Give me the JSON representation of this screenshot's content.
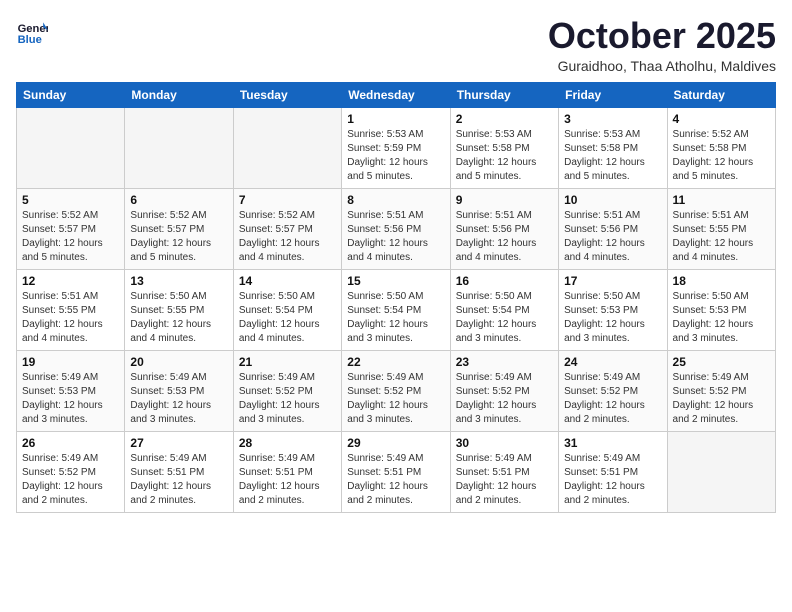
{
  "header": {
    "logo_line1": "General",
    "logo_line2": "Blue",
    "month": "October 2025",
    "location": "Guraidhoo, Thaa Atholhu, Maldives"
  },
  "weekdays": [
    "Sunday",
    "Monday",
    "Tuesday",
    "Wednesday",
    "Thursday",
    "Friday",
    "Saturday"
  ],
  "weeks": [
    [
      {
        "day": "",
        "info": ""
      },
      {
        "day": "",
        "info": ""
      },
      {
        "day": "",
        "info": ""
      },
      {
        "day": "1",
        "info": "Sunrise: 5:53 AM\nSunset: 5:59 PM\nDaylight: 12 hours\nand 5 minutes."
      },
      {
        "day": "2",
        "info": "Sunrise: 5:53 AM\nSunset: 5:58 PM\nDaylight: 12 hours\nand 5 minutes."
      },
      {
        "day": "3",
        "info": "Sunrise: 5:53 AM\nSunset: 5:58 PM\nDaylight: 12 hours\nand 5 minutes."
      },
      {
        "day": "4",
        "info": "Sunrise: 5:52 AM\nSunset: 5:58 PM\nDaylight: 12 hours\nand 5 minutes."
      }
    ],
    [
      {
        "day": "5",
        "info": "Sunrise: 5:52 AM\nSunset: 5:57 PM\nDaylight: 12 hours\nand 5 minutes."
      },
      {
        "day": "6",
        "info": "Sunrise: 5:52 AM\nSunset: 5:57 PM\nDaylight: 12 hours\nand 5 minutes."
      },
      {
        "day": "7",
        "info": "Sunrise: 5:52 AM\nSunset: 5:57 PM\nDaylight: 12 hours\nand 4 minutes."
      },
      {
        "day": "8",
        "info": "Sunrise: 5:51 AM\nSunset: 5:56 PM\nDaylight: 12 hours\nand 4 minutes."
      },
      {
        "day": "9",
        "info": "Sunrise: 5:51 AM\nSunset: 5:56 PM\nDaylight: 12 hours\nand 4 minutes."
      },
      {
        "day": "10",
        "info": "Sunrise: 5:51 AM\nSunset: 5:56 PM\nDaylight: 12 hours\nand 4 minutes."
      },
      {
        "day": "11",
        "info": "Sunrise: 5:51 AM\nSunset: 5:55 PM\nDaylight: 12 hours\nand 4 minutes."
      }
    ],
    [
      {
        "day": "12",
        "info": "Sunrise: 5:51 AM\nSunset: 5:55 PM\nDaylight: 12 hours\nand 4 minutes."
      },
      {
        "day": "13",
        "info": "Sunrise: 5:50 AM\nSunset: 5:55 PM\nDaylight: 12 hours\nand 4 minutes."
      },
      {
        "day": "14",
        "info": "Sunrise: 5:50 AM\nSunset: 5:54 PM\nDaylight: 12 hours\nand 4 minutes."
      },
      {
        "day": "15",
        "info": "Sunrise: 5:50 AM\nSunset: 5:54 PM\nDaylight: 12 hours\nand 3 minutes."
      },
      {
        "day": "16",
        "info": "Sunrise: 5:50 AM\nSunset: 5:54 PM\nDaylight: 12 hours\nand 3 minutes."
      },
      {
        "day": "17",
        "info": "Sunrise: 5:50 AM\nSunset: 5:53 PM\nDaylight: 12 hours\nand 3 minutes."
      },
      {
        "day": "18",
        "info": "Sunrise: 5:50 AM\nSunset: 5:53 PM\nDaylight: 12 hours\nand 3 minutes."
      }
    ],
    [
      {
        "day": "19",
        "info": "Sunrise: 5:49 AM\nSunset: 5:53 PM\nDaylight: 12 hours\nand 3 minutes."
      },
      {
        "day": "20",
        "info": "Sunrise: 5:49 AM\nSunset: 5:53 PM\nDaylight: 12 hours\nand 3 minutes."
      },
      {
        "day": "21",
        "info": "Sunrise: 5:49 AM\nSunset: 5:52 PM\nDaylight: 12 hours\nand 3 minutes."
      },
      {
        "day": "22",
        "info": "Sunrise: 5:49 AM\nSunset: 5:52 PM\nDaylight: 12 hours\nand 3 minutes."
      },
      {
        "day": "23",
        "info": "Sunrise: 5:49 AM\nSunset: 5:52 PM\nDaylight: 12 hours\nand 3 minutes."
      },
      {
        "day": "24",
        "info": "Sunrise: 5:49 AM\nSunset: 5:52 PM\nDaylight: 12 hours\nand 2 minutes."
      },
      {
        "day": "25",
        "info": "Sunrise: 5:49 AM\nSunset: 5:52 PM\nDaylight: 12 hours\nand 2 minutes."
      }
    ],
    [
      {
        "day": "26",
        "info": "Sunrise: 5:49 AM\nSunset: 5:52 PM\nDaylight: 12 hours\nand 2 minutes."
      },
      {
        "day": "27",
        "info": "Sunrise: 5:49 AM\nSunset: 5:51 PM\nDaylight: 12 hours\nand 2 minutes."
      },
      {
        "day": "28",
        "info": "Sunrise: 5:49 AM\nSunset: 5:51 PM\nDaylight: 12 hours\nand 2 minutes."
      },
      {
        "day": "29",
        "info": "Sunrise: 5:49 AM\nSunset: 5:51 PM\nDaylight: 12 hours\nand 2 minutes."
      },
      {
        "day": "30",
        "info": "Sunrise: 5:49 AM\nSunset: 5:51 PM\nDaylight: 12 hours\nand 2 minutes."
      },
      {
        "day": "31",
        "info": "Sunrise: 5:49 AM\nSunset: 5:51 PM\nDaylight: 12 hours\nand 2 minutes."
      },
      {
        "day": "",
        "info": ""
      }
    ]
  ]
}
